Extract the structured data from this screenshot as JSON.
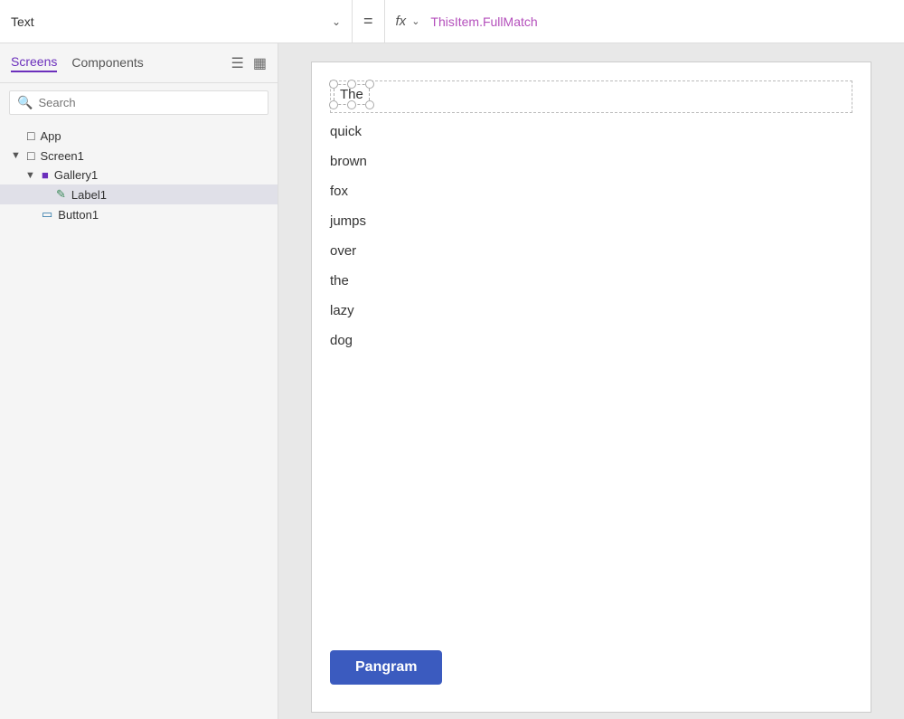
{
  "topbar": {
    "property_label": "Text",
    "equals": "=",
    "fx_label": "fx",
    "formula": "ThisItem.FullMatch"
  },
  "panel": {
    "tab_screens": "Screens",
    "tab_components": "Components",
    "search_placeholder": "Search",
    "tree": [
      {
        "id": "app",
        "label": "App",
        "icon": "app",
        "level": 0,
        "chevron": false
      },
      {
        "id": "screen1",
        "label": "Screen1",
        "icon": "screen",
        "level": 0,
        "chevron": true,
        "expanded": true
      },
      {
        "id": "gallery1",
        "label": "Gallery1",
        "icon": "gallery",
        "level": 1,
        "chevron": true,
        "expanded": true
      },
      {
        "id": "label1",
        "label": "Label1",
        "icon": "label",
        "level": 2,
        "chevron": false,
        "selected": true
      },
      {
        "id": "button1",
        "label": "Button1",
        "icon": "button",
        "level": 1,
        "chevron": false
      }
    ]
  },
  "canvas": {
    "selected_text": "The",
    "gallery_words": [
      "quick",
      "brown",
      "fox",
      "jumps",
      "over",
      "the",
      "lazy",
      "dog"
    ],
    "button_label": "Pangram"
  }
}
